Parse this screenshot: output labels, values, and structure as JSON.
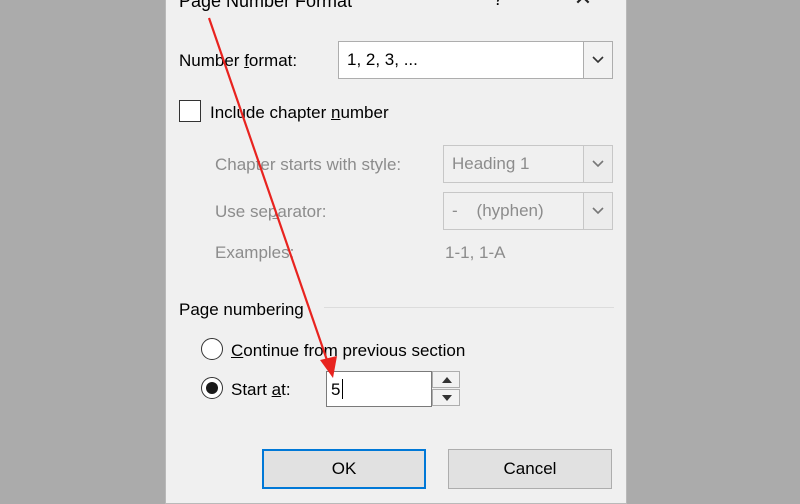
{
  "dialog": {
    "title": "Page Number Format",
    "help_symbol": "?",
    "close_symbol": "✕"
  },
  "number_format": {
    "label_pre": "Number ",
    "label_accel": "f",
    "label_post": "ormat:",
    "value": "1, 2, 3, ..."
  },
  "include_chapter": {
    "label_pre": "Include chapter ",
    "label_accel": "n",
    "label_post": "umber",
    "checked": false
  },
  "chapter_style": {
    "label": "Chapter starts with style:",
    "value": "Heading 1"
  },
  "separator": {
    "label_pre": "Use se",
    "label_accel": "p",
    "label_post": "arator:",
    "value": "-    (hyphen)"
  },
  "examples": {
    "label": "Examples:",
    "value": "1-1, 1-A"
  },
  "page_numbering": {
    "heading": "Page numbering",
    "continue_accel": "C",
    "continue_post": "ontinue from previous section",
    "start_pre": "Start ",
    "start_accel": "a",
    "start_post": "t:",
    "start_value": "5",
    "selected": "start"
  },
  "buttons": {
    "ok": "OK",
    "cancel": "Cancel"
  },
  "colors": {
    "accent": "#0078d7",
    "annotation_arrow": "#e8231f"
  },
  "icons": {
    "dropdown": "chevron-down-icon",
    "spin_up": "arrow-up-icon",
    "spin_down": "arrow-down-icon"
  }
}
